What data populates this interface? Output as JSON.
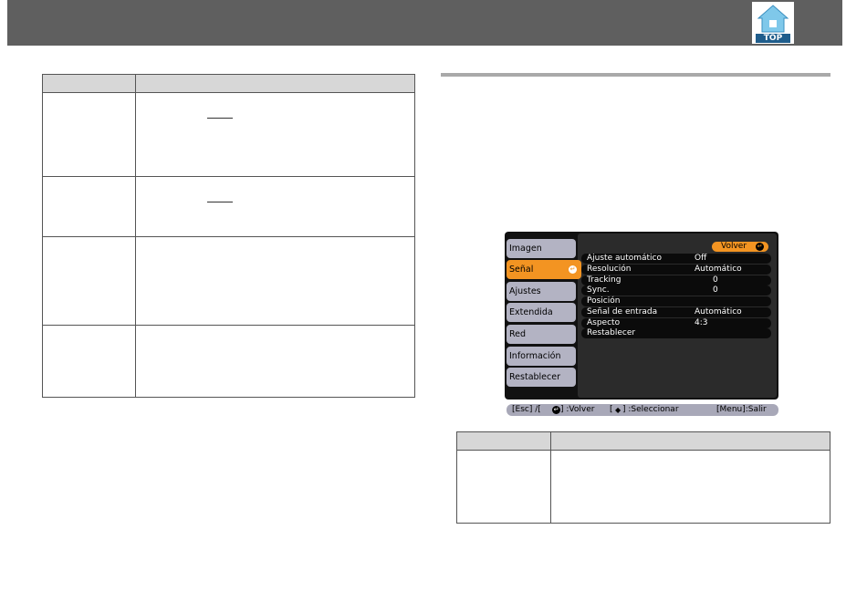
{
  "header": {
    "logo_label": "TOP"
  },
  "menu": {
    "tabs": [
      "Imagen",
      "Señal",
      "Ajustes",
      "Extendida",
      "Red",
      "Información",
      "Restablecer"
    ],
    "active_tab": "Señal",
    "back_label": "Volver",
    "rows": [
      {
        "label": "Ajuste automático",
        "value": "Off"
      },
      {
        "label": "Resolución",
        "value": "Automático"
      },
      {
        "label": "Tracking",
        "value": "0"
      },
      {
        "label": "Sync.",
        "value": "0"
      },
      {
        "label": "Posición",
        "value": ""
      },
      {
        "label": "Señal de entrada",
        "value": "Automático"
      },
      {
        "label": "Aspecto",
        "value": "4:3"
      },
      {
        "label": "Restablecer",
        "value": ""
      }
    ],
    "status": {
      "back": "[Esc] /[",
      "back_suffix": "] :Volver",
      "select": "[",
      "select_suffix": "] :Seleccionar",
      "exit": "[Menu]:Salir"
    }
  }
}
